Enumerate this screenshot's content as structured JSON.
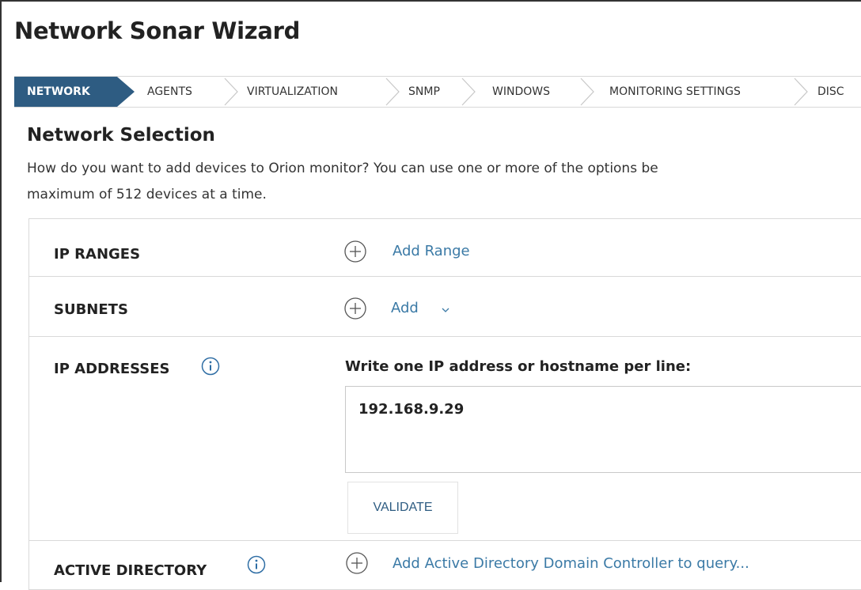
{
  "window": {
    "title": "Network Sonar Wizard"
  },
  "steps": [
    {
      "label": "NETWORK"
    },
    {
      "label": "AGENTS"
    },
    {
      "label": "VIRTUALIZATION"
    },
    {
      "label": "SNMP"
    },
    {
      "label": "WINDOWS"
    },
    {
      "label": "MONITORING SETTINGS"
    },
    {
      "label": "DISC"
    }
  ],
  "section": {
    "title": "Network Selection",
    "desc_line1": "How do you want to add devices to Orion monitor? You can use one or more of the options be",
    "desc_line2": "maximum of 512 devices at a time."
  },
  "rows": {
    "ip_ranges": {
      "label": "IP RANGES",
      "action": "Add Range"
    },
    "subnets": {
      "label": "SUBNETS",
      "action": "Add"
    },
    "ip_addresses": {
      "label": "IP ADDRESSES",
      "instruction": "Write one IP address or hostname per line:",
      "value": "192.168.9.29",
      "validate_label": "VALIDATE"
    },
    "active_directory": {
      "label": "ACTIVE DIRECTORY",
      "action": "Add Active Directory Domain Controller to query..."
    }
  },
  "icons": {
    "plus": "plus-circle-icon",
    "info": "info-circle-icon",
    "caret": "chevron-down-icon",
    "step_separator": "chevron-right-icon"
  },
  "colors": {
    "accent": "#2e5c82",
    "link": "#3b7aa6",
    "border": "#d9d9d9"
  }
}
